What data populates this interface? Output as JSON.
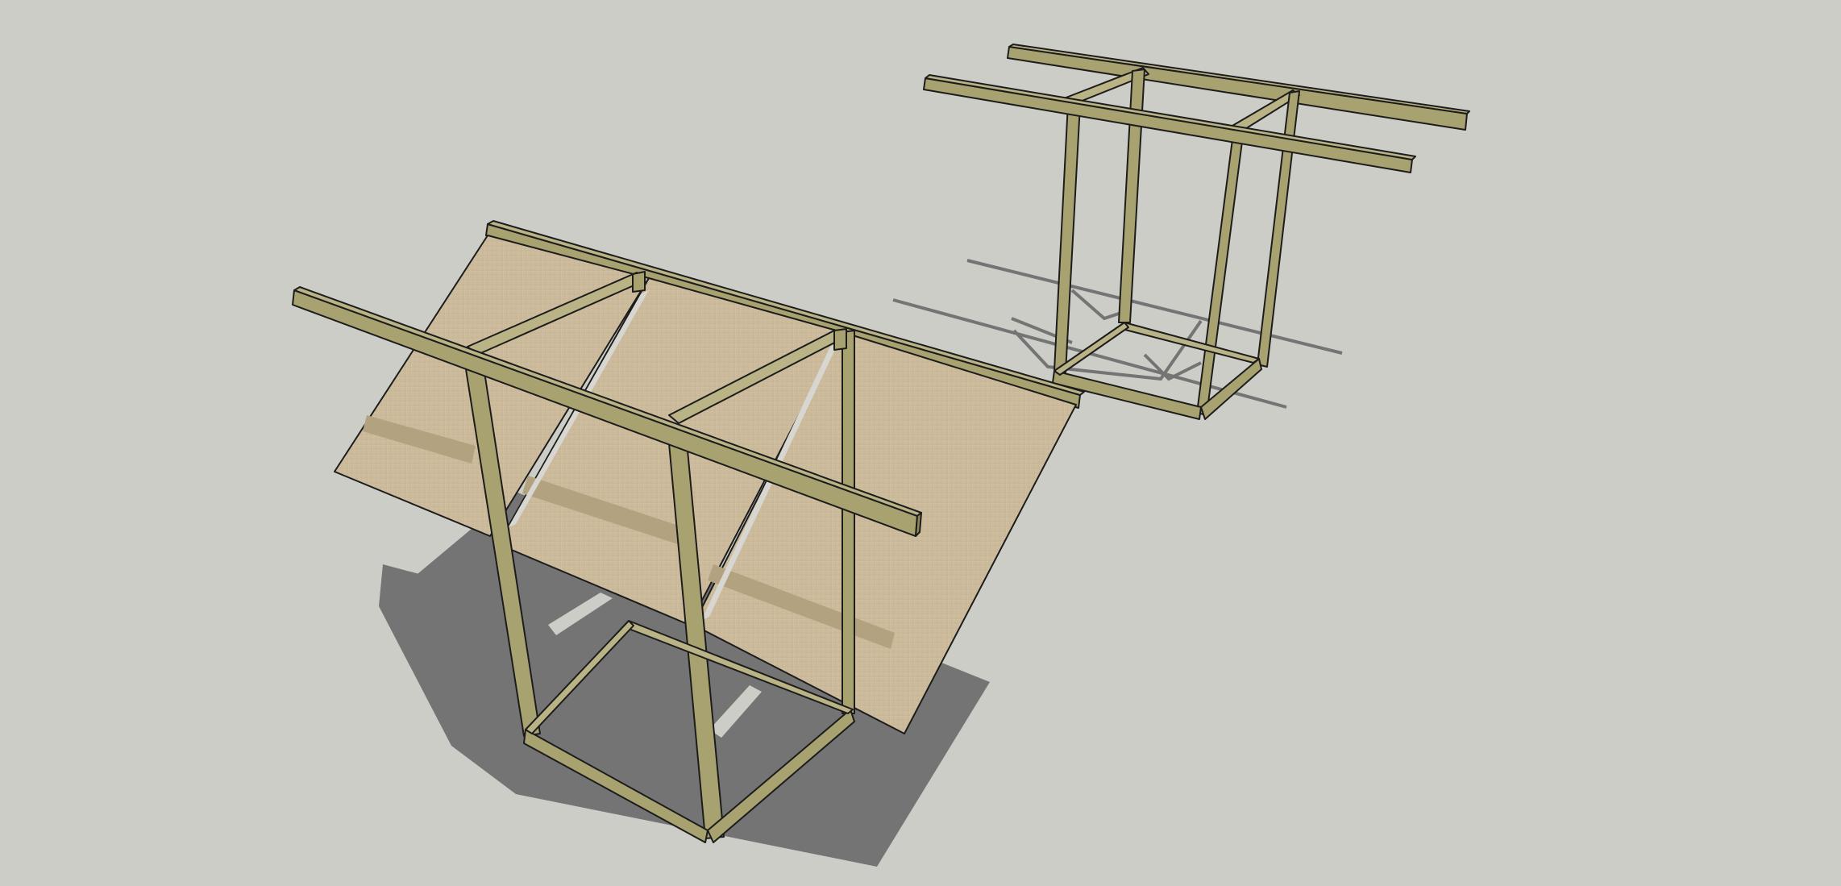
{
  "scene": {
    "background_color": "#cdcdc8",
    "ground_shadow_color": "#747474",
    "wood_color": "#a8a271",
    "wood_light": "#b9b386",
    "wood_dark": "#8e8958",
    "panel_color": "#cbb999",
    "panel_shadow": "#b3a27f",
    "outline_color": "#1c1c1c",
    "objects": [
      {
        "name": "table-frame-with-tilted-panels"
      },
      {
        "name": "table-frame-bare"
      }
    ]
  }
}
